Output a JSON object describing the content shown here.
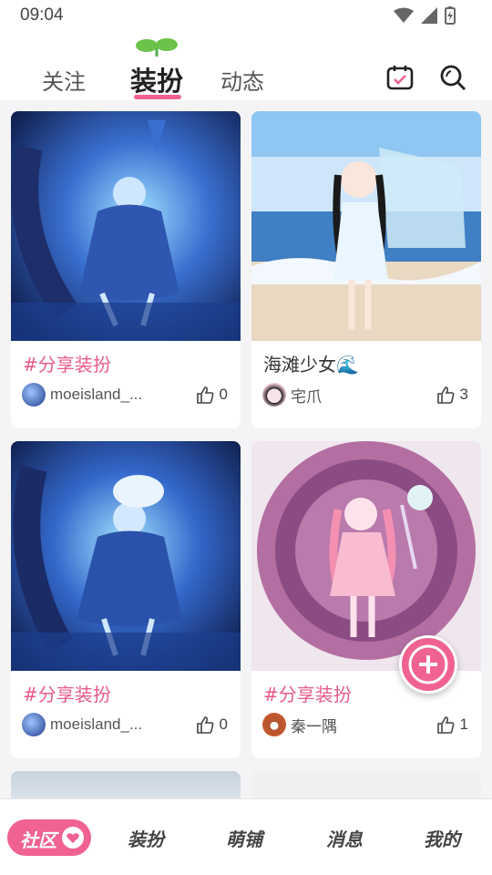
{
  "status_bar": {
    "time": "09:04"
  },
  "top_tabs": [
    {
      "label": "关注",
      "active": false
    },
    {
      "label": "装扮",
      "active": true
    },
    {
      "label": "动态",
      "active": false
    }
  ],
  "icons": {
    "calendar": "calendar-check-icon",
    "search": "search-icon",
    "add": "plus-icon",
    "like": "thumbs-up-icon"
  },
  "colors": {
    "accent": "#f06292",
    "tag_text": "#e85a8a"
  },
  "posts": [
    {
      "title": "#分享装扮",
      "author": "moeisland_...",
      "likes": "0",
      "image": "blue fantasy girl in moonlit forest"
    },
    {
      "title": "海滩少女🌊",
      "author": "宅爪",
      "likes": "3",
      "image": "girl with glass piano at beach"
    },
    {
      "title": "#分享装扮",
      "author": "moeisland_...",
      "likes": "0",
      "image": "blue fantasy girl in moonlit forest"
    },
    {
      "title": "#分享装扮",
      "author": "秦一隅",
      "likes": "1",
      "image": "pink sweet party girl"
    }
  ],
  "bottom_nav": [
    {
      "label": "社区",
      "active": true
    },
    {
      "label": "装扮",
      "active": false
    },
    {
      "label": "萌铺",
      "active": false
    },
    {
      "label": "消息",
      "active": false
    },
    {
      "label": "我的",
      "active": false
    }
  ]
}
